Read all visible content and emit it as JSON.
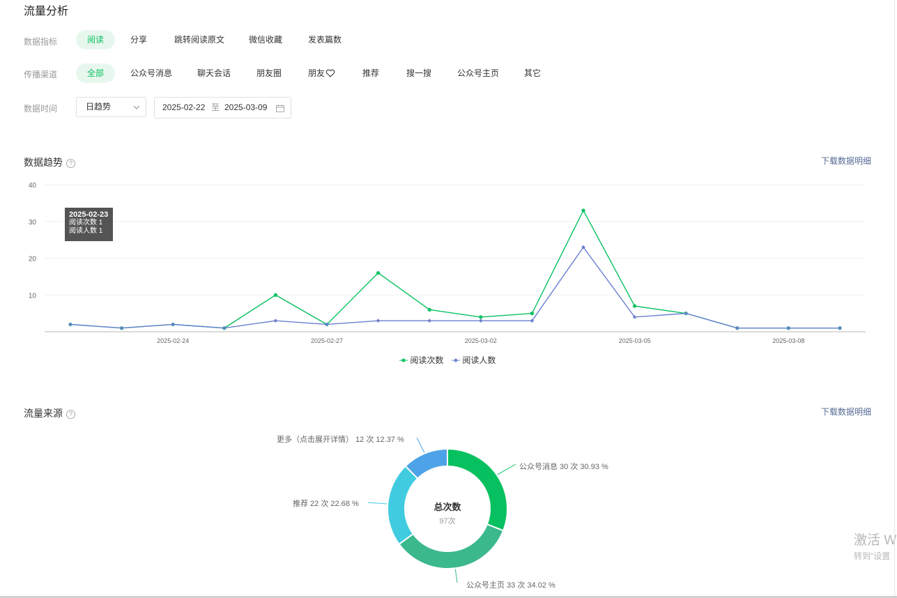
{
  "page_title": "流量分析",
  "filters": {
    "metric": {
      "label": "数据指标",
      "options": [
        "阅读",
        "分享",
        "跳转阅读原文",
        "微信收藏",
        "发表篇数"
      ],
      "active_index": 0
    },
    "channel": {
      "label": "传播渠道",
      "options": [
        "全部",
        "公众号消息",
        "聊天会话",
        "朋友圈",
        "朋友",
        "推荐",
        "搜一搜",
        "公众号主页",
        "其它"
      ],
      "active_index": 0
    },
    "time": {
      "label": "数据时间",
      "granularity": "日趋势",
      "start_date": "2025-02-22",
      "separator": "至",
      "end_date": "2025-03-09"
    }
  },
  "trend_section": {
    "title": "数据趋势",
    "download": "下载数据明细",
    "tooltip": {
      "date": "2025-02-23",
      "line1": "阅读次数 1",
      "line2": "阅读人数 1"
    }
  },
  "chart_data": [
    {
      "type": "line",
      "x": [
        "2025-02-22",
        "2025-02-23",
        "2025-02-24",
        "2025-02-25",
        "2025-02-26",
        "2025-02-27",
        "2025-02-28",
        "2025-03-01",
        "2025-03-02",
        "2025-03-03",
        "2025-03-04",
        "2025-03-05",
        "2025-03-06",
        "2025-03-07",
        "2025-03-08",
        "2025-03-09"
      ],
      "x_tick_labels": [
        "2025-02-24",
        "2025-02-27",
        "2025-03-02",
        "2025-03-05",
        "2025-03-08"
      ],
      "y_tick_labels": [
        "10",
        "20",
        "30",
        "40"
      ],
      "ylim": [
        0,
        40
      ],
      "grid": true,
      "legend_position": "bottom",
      "series": [
        {
          "name": "阅读次数",
          "color": "#07c160",
          "values": [
            2,
            1,
            2,
            1,
            10,
            2,
            16,
            6,
            4,
            5,
            33,
            7,
            5,
            1,
            1,
            1
          ]
        },
        {
          "name": "阅读人数",
          "color": "#6a7fcf",
          "values": [
            2,
            1,
            2,
            1,
            3,
            2,
            3,
            3,
            3,
            3,
            23,
            4,
            5,
            1,
            1,
            1
          ]
        }
      ]
    },
    {
      "type": "pie",
      "title": "流量来源",
      "center_title": "总次数",
      "center_value": "97次",
      "slices": [
        {
          "name": "公众号消息",
          "value": 30,
          "percent": 30.93,
          "label": "公众号消息 30 次 30.93 %",
          "color": "#07c160"
        },
        {
          "name": "公众号主页",
          "value": 33,
          "percent": 34.02,
          "label": "公众号主页 33 次 34.02 %",
          "color": "#3bb98c"
        },
        {
          "name": "推荐",
          "value": 22,
          "percent": 22.68,
          "label": "推荐 22 次 22.68 %",
          "color": "#40cbe0"
        },
        {
          "name": "更多（点击展开详情）",
          "value": 12,
          "percent": 12.37,
          "label": "更多（点击展开详情） 12 次 12.37 %",
          "color": "#4ea3e8"
        }
      ]
    }
  ],
  "source_section": {
    "title": "流量来源",
    "download": "下载数据明细"
  },
  "watermark": {
    "line1": "激活 W",
    "line2": "转到\"设置"
  },
  "icons": {
    "help": "help-circle-icon",
    "chevron": "chevron-down-icon",
    "calendar": "calendar-icon",
    "heart": "heart-icon"
  }
}
